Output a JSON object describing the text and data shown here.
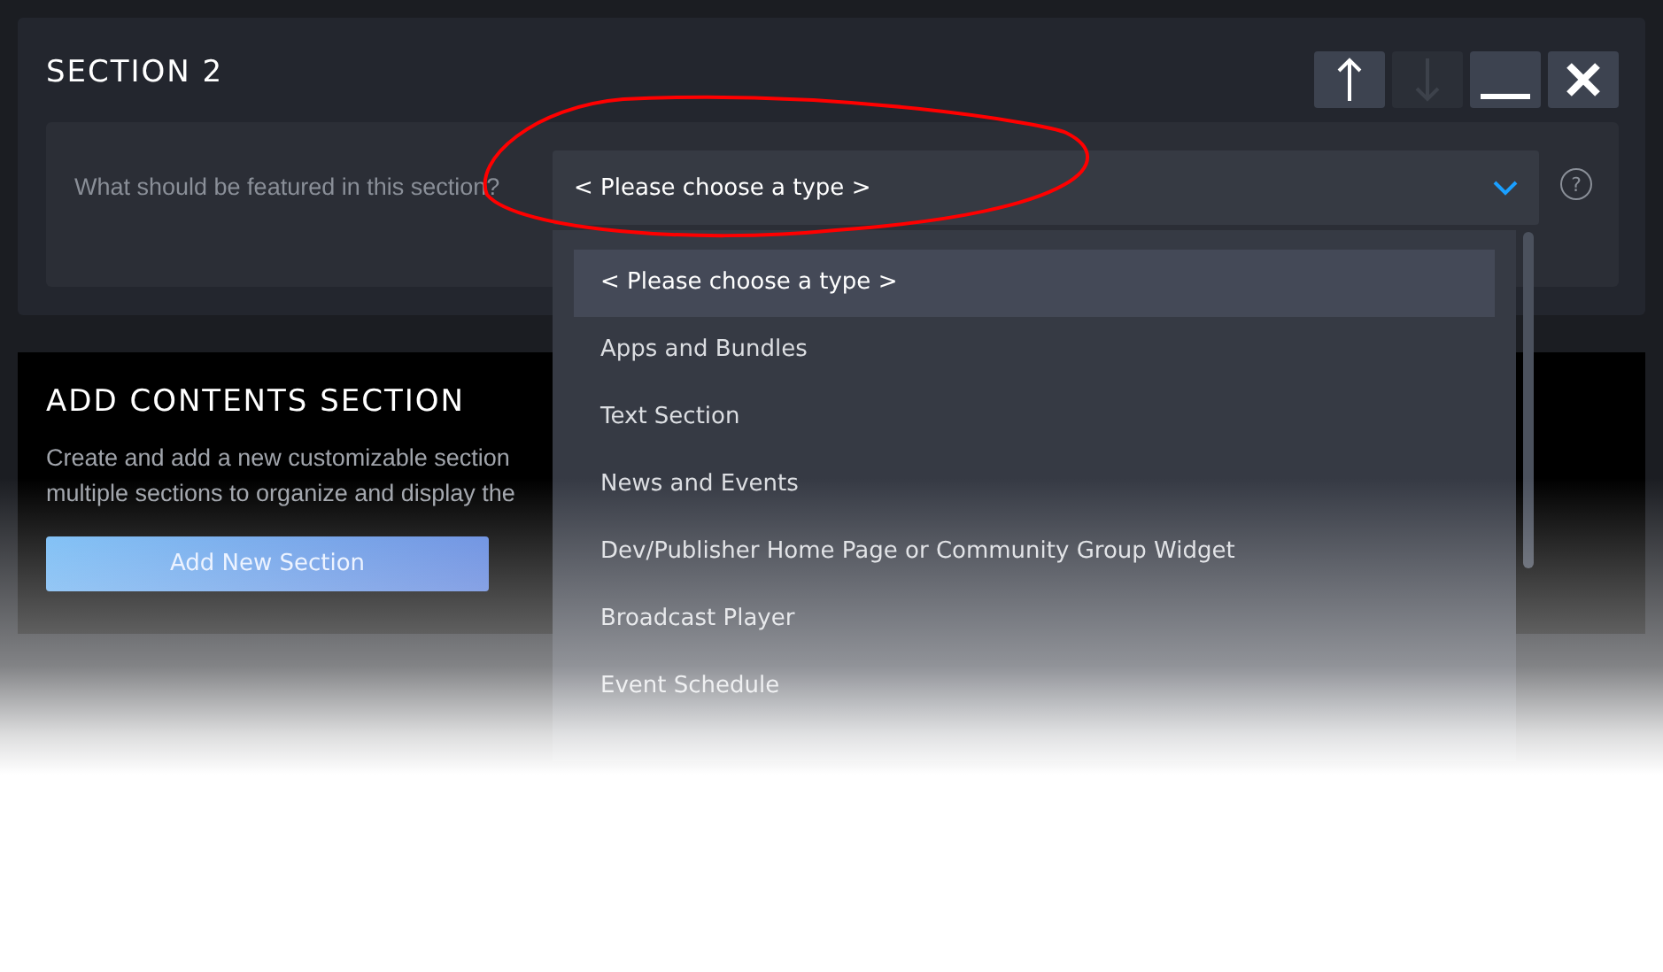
{
  "section": {
    "title": "SECTION 2",
    "buttons": [
      {
        "kind": "up",
        "disabled": false
      },
      {
        "kind": "down",
        "disabled": true
      },
      {
        "kind": "minimize",
        "disabled": false
      },
      {
        "kind": "close",
        "disabled": false
      }
    ],
    "question": "What should be featured in this section?",
    "select": {
      "value": "< Please choose a type >"
    },
    "help": "?"
  },
  "dropdown": {
    "options": [
      {
        "label": "< Please choose a type >",
        "selected": true
      },
      {
        "label": "Apps and Bundles",
        "selected": false
      },
      {
        "label": "Text Section",
        "selected": false
      },
      {
        "label": "News and Events",
        "selected": false
      },
      {
        "label": "Dev/Publisher Home Page or Community Group Widget",
        "selected": false
      },
      {
        "label": "Broadcast Player",
        "selected": false
      },
      {
        "label": "Event Schedule",
        "selected": false
      }
    ]
  },
  "add_section": {
    "title": "ADD CONTENTS SECTION",
    "description": [
      "Create and add a new customizable section",
      "multiple sections to organize and display the"
    ],
    "button": "Add New Section"
  }
}
